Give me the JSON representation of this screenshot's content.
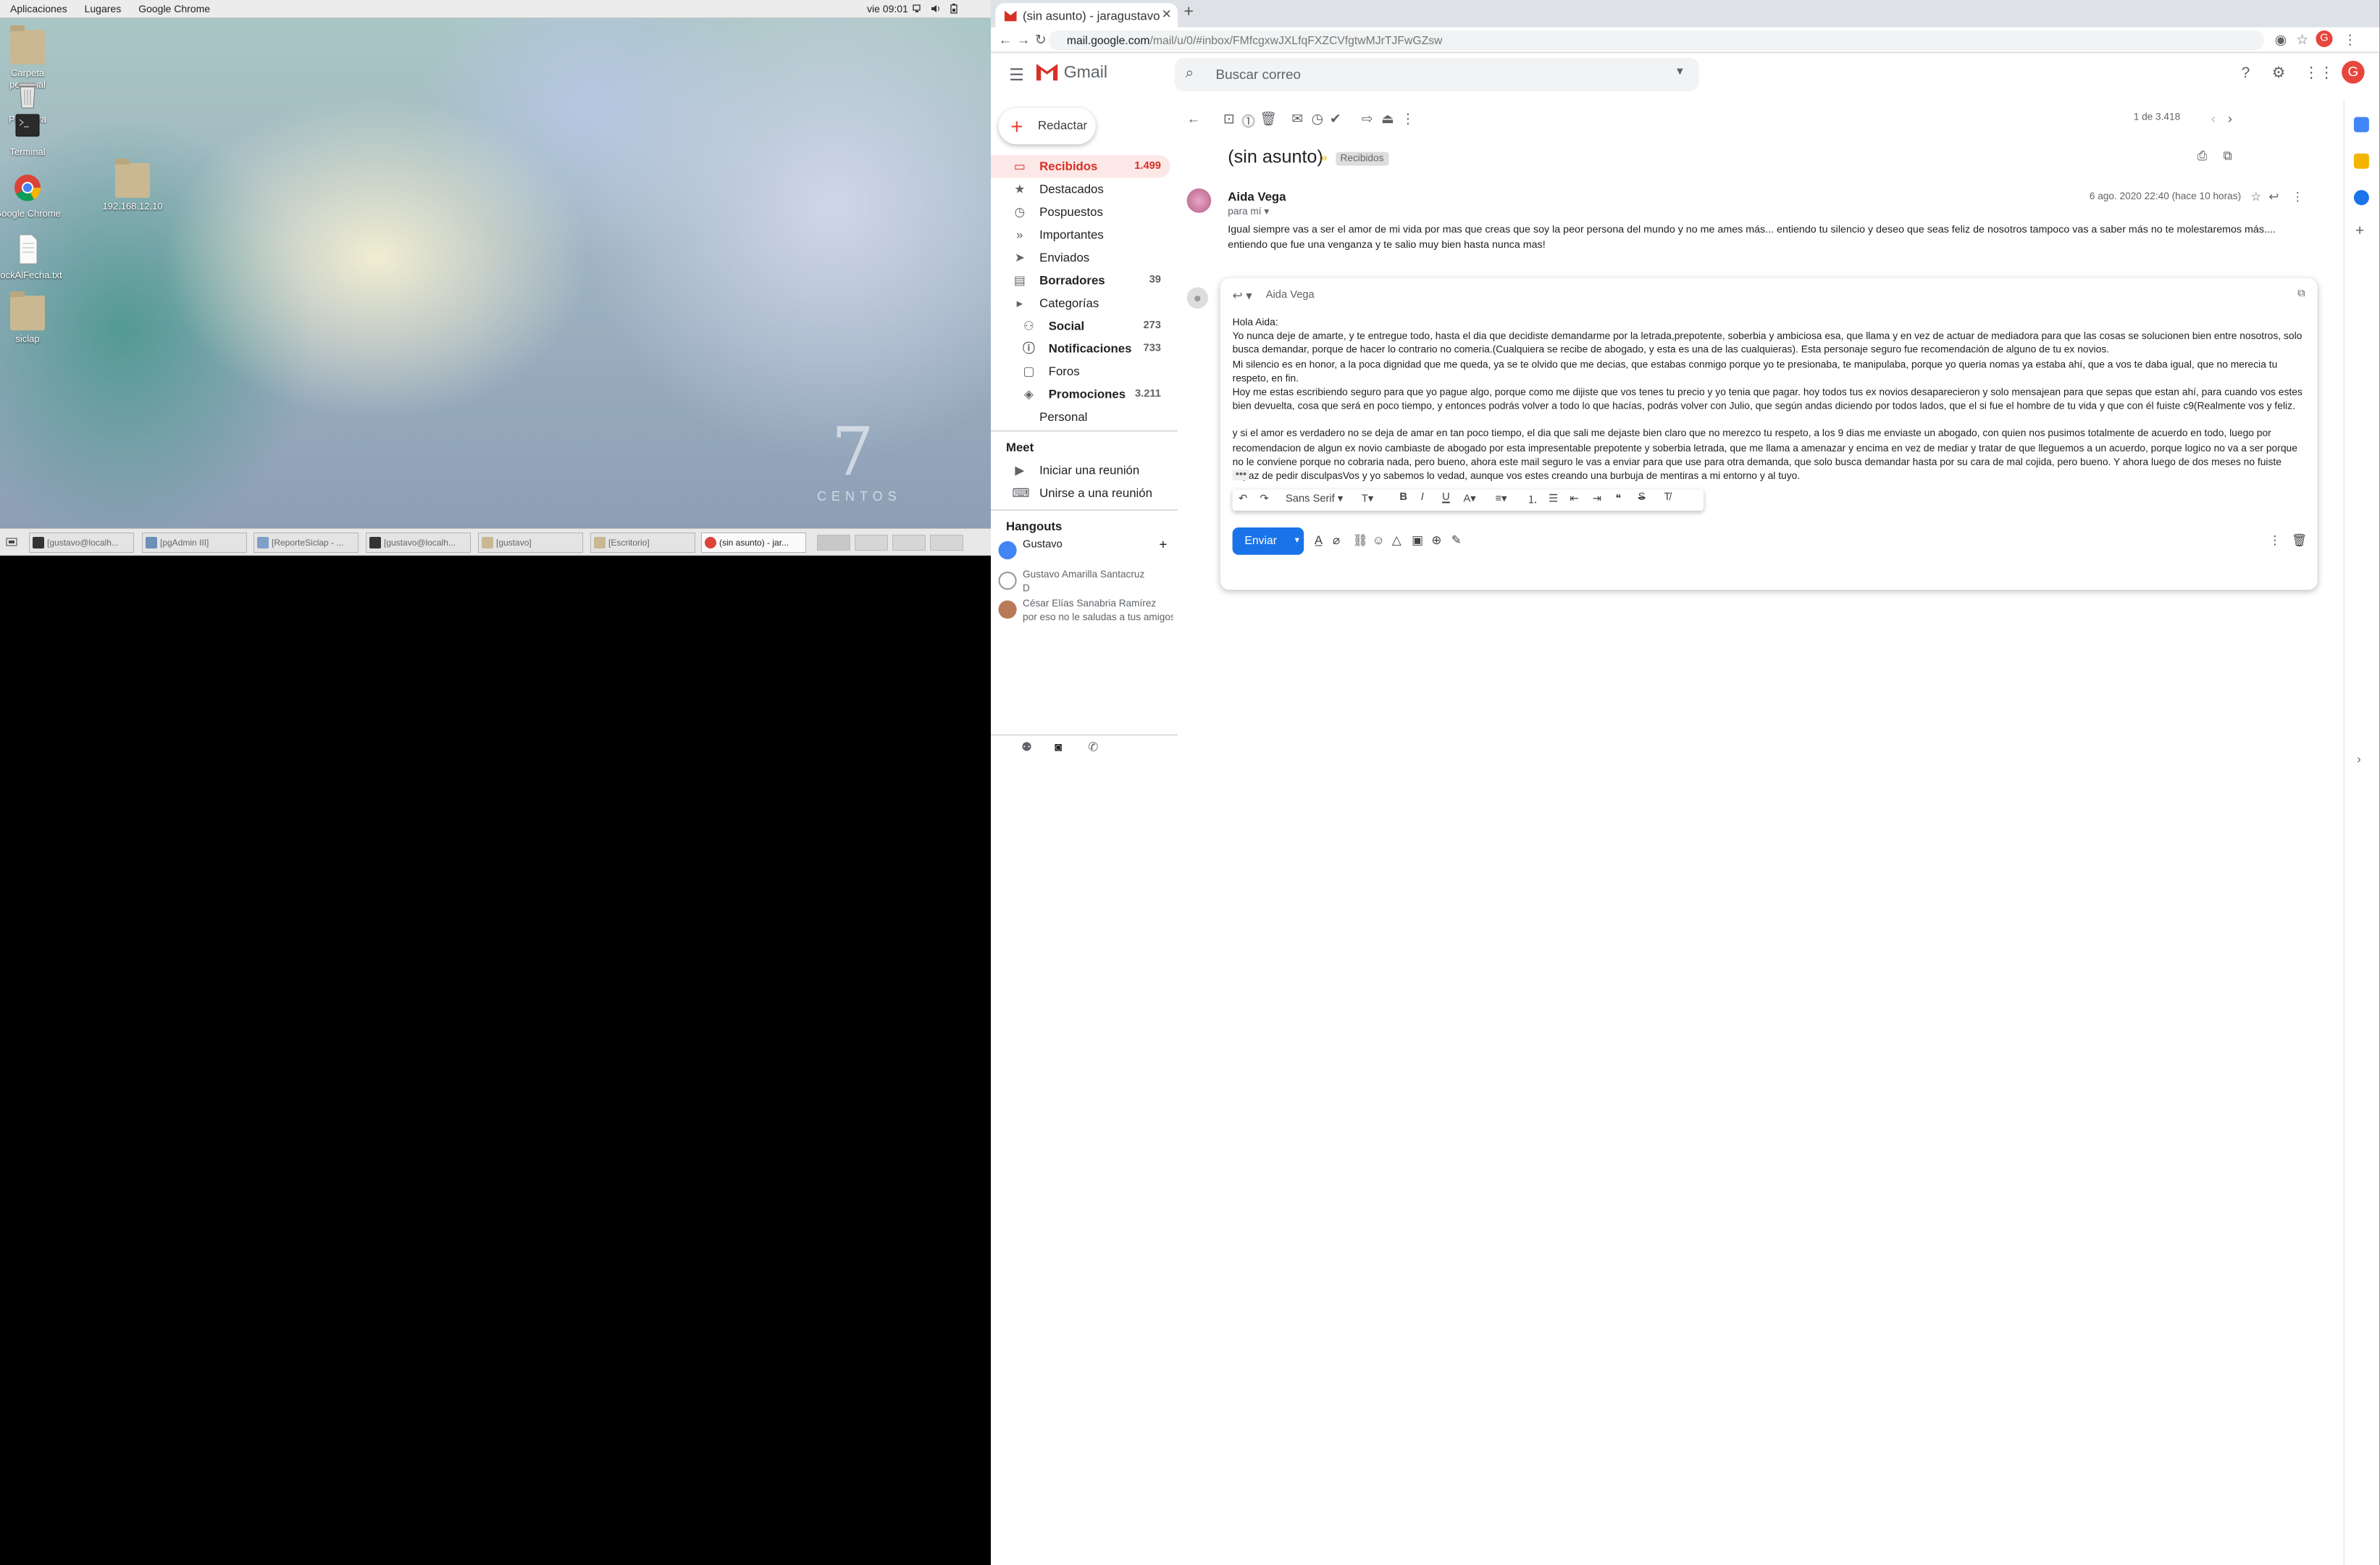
{
  "desktop": {
    "topbar": {
      "menu": [
        "Aplicaciones",
        "Lugares",
        "Google Chrome"
      ],
      "clock": "vie 09:01"
    },
    "icons": [
      {
        "label": "Carpeta personal"
      },
      {
        "label": "Papelera"
      },
      {
        "label": "Terminal"
      },
      {
        "label": "Google Chrome"
      },
      {
        "label": "stockAlFecha.txt"
      },
      {
        "label": "siclap"
      },
      {
        "label": "192.168.12.10"
      }
    ],
    "wallpaper": {
      "big": "7",
      "word": "CENTOS"
    },
    "taskbar": [
      "[gustavo@localh...",
      "[pgAdmin III]",
      "[ReporteSiclap - ...",
      "[gustavo@localh...",
      "[gustavo]",
      "[Escritorio]",
      "(sin asunto) - jar..."
    ]
  },
  "browser": {
    "tab_title": "(sin asunto) - jaragustavo",
    "url_host": "mail.google.com",
    "url_path": "/mail/u/0/#inbox/FMfcgxwJXLfqFXZCVfgtwMJrTJFwGZsw"
  },
  "gmail": {
    "brand": "Gmail",
    "search_placeholder": "Buscar correo",
    "compose": "Redactar",
    "nav": [
      {
        "label": "Recibidos",
        "count": "1.499"
      },
      {
        "label": "Destacados",
        "count": ""
      },
      {
        "label": "Pospuestos",
        "count": ""
      },
      {
        "label": "Importantes",
        "count": ""
      },
      {
        "label": "Enviados",
        "count": ""
      },
      {
        "label": "Borradores",
        "count": "39"
      },
      {
        "label": "Categorías",
        "count": ""
      },
      {
        "label": "Social",
        "count": "273"
      },
      {
        "label": "Notificaciones",
        "count": "733"
      },
      {
        "label": "Foros",
        "count": ""
      },
      {
        "label": "Promociones",
        "count": "3.211"
      },
      {
        "label": "Personal",
        "count": ""
      }
    ],
    "meet": {
      "title": "Meet",
      "items": [
        "Iniciar una reunión",
        "Unirse a una reunión"
      ]
    },
    "hangouts": {
      "title": "Hangouts",
      "me": "Gustavo",
      "contacts": [
        {
          "name": "Gustavo Amarilla Santacruz",
          "line2": "D"
        },
        {
          "name": "César Elías Sanabria Ramírez",
          "line2": "por eso no le saludas a tus amigos pc"
        }
      ]
    },
    "pager": "1 de 3.418",
    "message": {
      "subject": "(sin asunto)",
      "label": "Recibidos",
      "sender": "Aida Vega",
      "to": "para mí",
      "date": "6 ago. 2020 22:40 (hace 10 horas)",
      "body": "Igual siempre vas a ser el amor de mi vida por mas que creas que soy la peor persona del mundo y no me ames más... entiendo tu silencio y deseo que seas feliz de nosotros tampoco vas a saber más no te molestaremos más.... entiendo que fue una venganza y te salio muy bien hasta nunca mas!"
    },
    "reply": {
      "to": "Aida Vega",
      "greeting": "Hola Aida:",
      "p1": "Yo nunca deje de amarte, y te entregue todo, hasta el dia que decidiste demandarme por la letrada,prepotente, soberbia y ambiciosa esa, que llama y en vez de actuar de mediadora para que las cosas se solucionen bien entre nosotros, solo busca demandar, porque de hacer lo contrario no comeria.(Cualquiera se recibe de abogado, y esta es una de las cualquieras). Esta personaje seguro fue recomendación de alguno de tu ex novios.",
      "p2": "Mi silencio es en honor,  a la poca dignidad  que me queda, ya se te olvido que me decias, que estabas conmigo porque yo te presionaba, te manipulaba, porque yo queria nomas ya estaba ahí, que a vos te daba igual, que no merecia tu respeto, en fin.",
      "p3": "Hoy me estas escribiendo seguro para que yo pague algo, porque como me dijiste que vos tenes tu precio y yo tenia que pagar. hoy todos tus ex novios desaparecieron y solo mensajean para que sepas que estan ahí, para cuando vos estes bien devuelta, cosa que será en poco tiempo, y entonces podrás volver a todo lo que hacías, podrás volver con Julio, que según andas diciendo por todos lados, que el si fue el hombre de tu vida y que con él fuiste c9(Realmente vos y feliz.",
      "p4": "y si el amor es verdadero no se deja de amar en tan poco tiempo, el dia que sali me dejaste bien claro que no merezco tu respeto, a los 9 dias me enviaste un abogado, con quien nos pusimos totalmente de acuerdo en todo, luego por recomendacion de algun ex novio cambiaste de abogado por esta impresentable prepotente y soberbia letrada,  que me llama a amenazar y encima en vez de mediar y tratar de que lleguemos a un acuerdo, porque logico no va a ser porque no le conviene porque no cobraria nada, pero bueno, ahora este mail seguro le vas a enviar para que use para otra demanda, que solo busca demandar hasta por  su cara de mal cojida, pero bueno. Y ahora luego de dos meses no fuiste capaz de pedir disculpasVos y yo sabemos lo vedad, aunque vos estes creando una burbuja de mentiras a mi entorno y al tuyo.",
      "font": "Sans Serif",
      "send": "Enviar"
    }
  }
}
